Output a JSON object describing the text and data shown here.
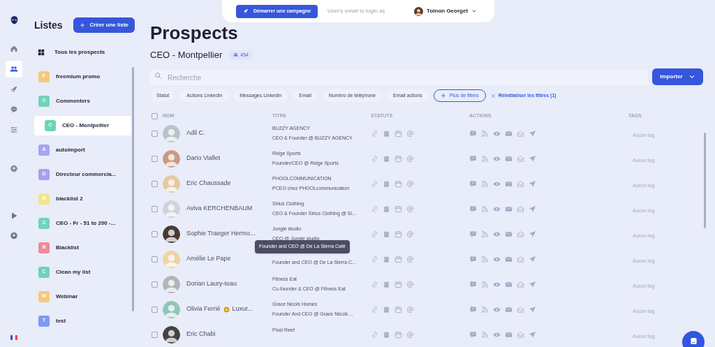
{
  "rail": {
    "items": [
      {
        "kind": "home",
        "selected": false
      },
      {
        "kind": "people",
        "selected": true
      },
      {
        "kind": "rocket",
        "selected": false
      },
      {
        "kind": "chat",
        "selected": false
      },
      {
        "kind": "sliders",
        "selected": false
      },
      {
        "kind": "gear",
        "selected": false
      }
    ],
    "bottom_items": [
      {
        "kind": "play"
      },
      {
        "kind": "gear"
      }
    ]
  },
  "lists_panel": {
    "title": "Listes",
    "create_button": "Créer une liste",
    "all_item": "Tous les prospects",
    "items": [
      {
        "initial": "F",
        "label": "freemium promo",
        "color": "#f5c97a",
        "selected": false
      },
      {
        "initial": "C",
        "label": "Commenters",
        "color": "#6fd3b8",
        "selected": false
      },
      {
        "initial": "C",
        "label": "CEO - Montpellier",
        "color": "#6fd3b8",
        "selected": true
      },
      {
        "initial": "A",
        "label": "autoimport",
        "color": "#a8a4f0",
        "selected": false
      },
      {
        "initial": "D",
        "label": "Directeur commercia...",
        "color": "#a99ff0",
        "selected": false
      },
      {
        "initial": "B",
        "label": "blacklist 2",
        "color": "#f3e58a",
        "selected": false
      },
      {
        "initial": "C",
        "label": "CEO - Fr - 51 to 200 -...",
        "color": "#6fd3b8",
        "selected": false
      },
      {
        "initial": "B",
        "label": "Blacklist",
        "color": "#ee8a9a",
        "selected": false
      },
      {
        "initial": "C",
        "label": "Clean my list",
        "color": "#6fd3b8",
        "selected": false
      },
      {
        "initial": "W",
        "label": "Webinar",
        "color": "#f5c97a",
        "selected": false
      },
      {
        "initial": "T",
        "label": "test",
        "color": "#7e9af0",
        "selected": false
      }
    ]
  },
  "top_bar": {
    "campaign_button": "Démarrer une campagne",
    "login_placeholder": "User's email to login as",
    "user_name": "Toinon Georget"
  },
  "page": {
    "title": "Prospects",
    "list_name": "CEO - Montpellier",
    "count": "454",
    "search_placeholder": "Recherche",
    "import_button": "Importer"
  },
  "filters": [
    {
      "kind": "chip",
      "label": "Statut"
    },
    {
      "kind": "chip",
      "label": "Actions Linkedin"
    },
    {
      "kind": "chip",
      "label": "Messages Linkedin"
    },
    {
      "kind": "chip",
      "label": "Email"
    },
    {
      "kind": "chip",
      "label": "Numéro de téléphone"
    },
    {
      "kind": "chip",
      "label": "Email actions"
    },
    {
      "kind": "more",
      "label": "Plus de filtres"
    },
    {
      "kind": "reset",
      "label": "Réinitialiser les filtres (1)"
    }
  ],
  "table": {
    "select_all_checked": false,
    "columns": [
      "NOM",
      "TITRE",
      "STATUTS",
      "ACTIONS",
      "TAGS"
    ],
    "rows": [
      {
        "checked": false,
        "name": "Adil C.",
        "company": "BUZZY AGENCY",
        "title": "CEO & Founder @ BUZZY AGENCY",
        "tag": "Aucun tag"
      },
      {
        "checked": false,
        "name": "Dario Viallet",
        "company": "Ridge Sports",
        "title": "Founder/CEO @ Ridge Sports",
        "tag": "Aucun tag"
      },
      {
        "checked": false,
        "name": "Eric Chaussade",
        "company": "PHOOLCOMMUNICATION",
        "title": "PCEO chez PHOOLcommunication",
        "tag": "Aucun tag"
      },
      {
        "checked": false,
        "name": "Aviva KERCHENBAUM",
        "company": "Sirius Clothing",
        "title": "CEO & Founder Sirius Clothing @ Si...",
        "tag": "Aucun tag"
      },
      {
        "checked": false,
        "name": "Sophie Traeger Hermo...",
        "company": "Jungle studio",
        "title": "CEO @ Jungle studio",
        "tag": "Aucun tag"
      },
      {
        "checked": false,
        "name": "Amélie Le Pape",
        "title": "Founder and CEO @ De La Sierra C...",
        "tag": "Aucun tag",
        "tooltip": "Founder and CEO @ De La Sierra Café"
      },
      {
        "checked": false,
        "name": "Dorian Laury-teau",
        "company": "Fitness Eat",
        "title": "Co-founder & CEO @ Fitness Eat",
        "tag": "Aucun tag"
      },
      {
        "checked": false,
        "name": "Olivia Ferrié",
        "emoji_badge": true,
        "name_extra": "Luxur...",
        "company": "Grace Nicols Homes",
        "title": "Founder And CEO @ Grace Nicols ...",
        "tag": "Aucun tag"
      },
      {
        "checked": false,
        "name": "Eric Chabi",
        "company": "Pixel Reef",
        "tag": "Aucun tag"
      }
    ]
  }
}
